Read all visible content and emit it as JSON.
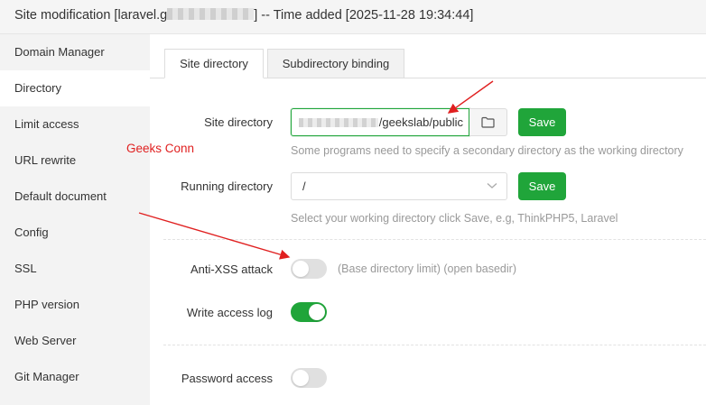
{
  "title": {
    "prefix": "Site modification [laravel.g",
    "suffix": "] -- Time added [2025-11-28 19:34:44]"
  },
  "sidebar": {
    "items": [
      {
        "label": "Domain Manager"
      },
      {
        "label": "Directory",
        "active": true
      },
      {
        "label": "Limit access"
      },
      {
        "label": "URL rewrite"
      },
      {
        "label": "Default document"
      },
      {
        "label": "Config"
      },
      {
        "label": "SSL"
      },
      {
        "label": "PHP version"
      },
      {
        "label": "Web Server"
      },
      {
        "label": "Git Manager"
      }
    ]
  },
  "watermark": "Geeks Conn",
  "tabs": [
    {
      "label": "Site directory",
      "active": true
    },
    {
      "label": "Subdirectory binding",
      "active": false
    }
  ],
  "form": {
    "site_directory": {
      "label": "Site directory",
      "value": "/geekslab/public",
      "hint": "Some programs need to specify a secondary directory as the working directory",
      "save_label": "Save",
      "folder_icon": "folder-icon"
    },
    "running_directory": {
      "label": "Running directory",
      "value": "/",
      "hint": "Select your working directory click Save, e.g, ThinkPHP5, Laravel",
      "save_label": "Save"
    },
    "anti_xss": {
      "label": "Anti-XSS attack",
      "note": "(Base directory limit) (open basedir)",
      "enabled": false
    },
    "write_access_log": {
      "label": "Write access log",
      "enabled": true
    },
    "password_access": {
      "label": "Password access",
      "enabled": false
    }
  },
  "colors": {
    "accent": "#20a53a",
    "annotation": "#e02020",
    "hint": "#999999"
  }
}
